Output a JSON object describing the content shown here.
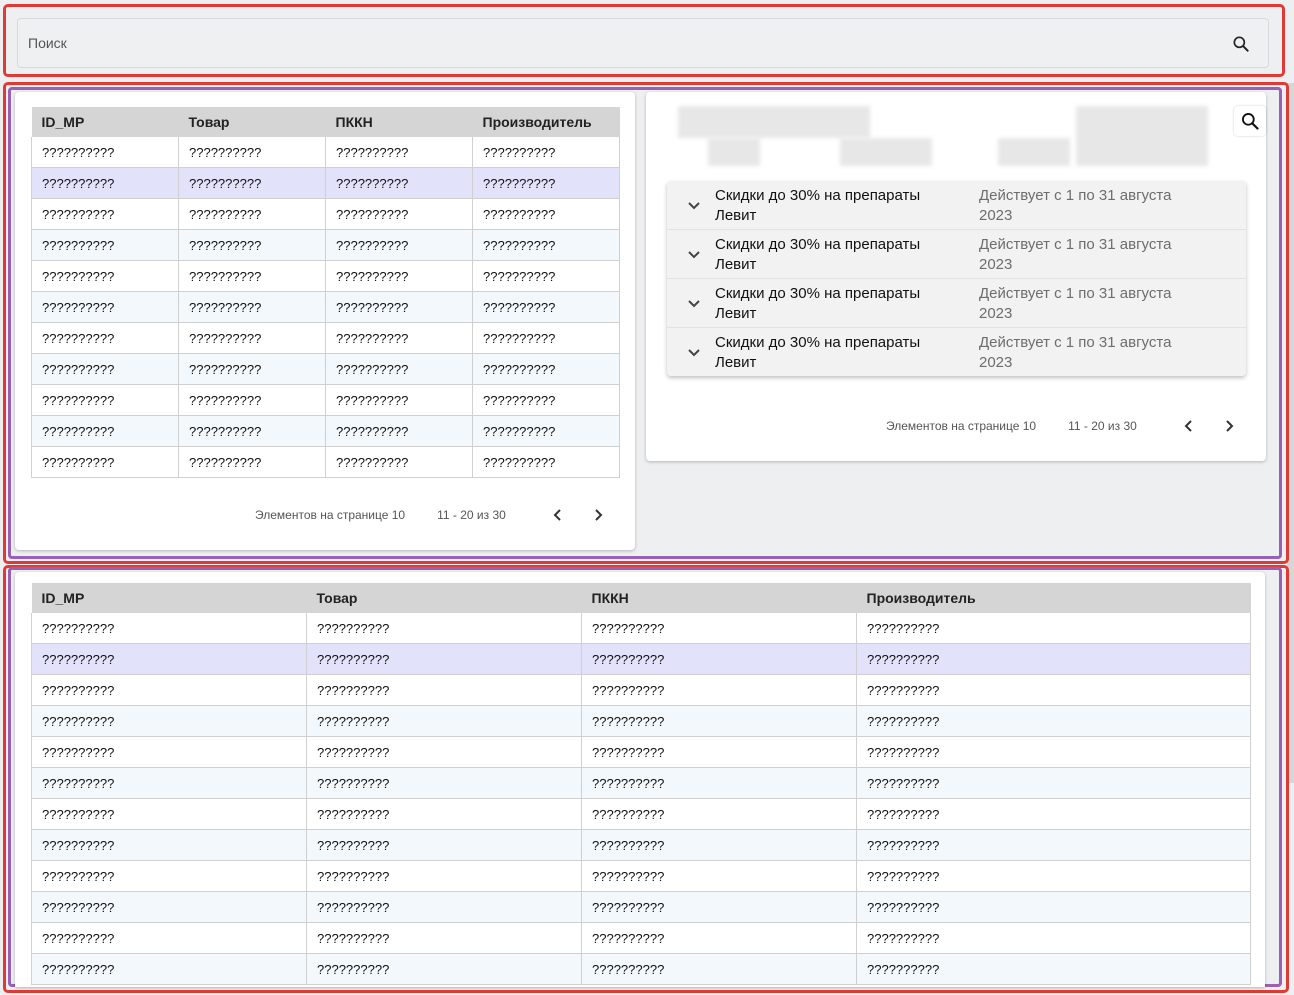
{
  "search": {
    "placeholder": "Поиск"
  },
  "left_table": {
    "columns": [
      "ID_MP",
      "Товар",
      "ПККН",
      "Производитель"
    ],
    "rows": [
      [
        "??????????",
        "??????????",
        "??????????",
        "??????????"
      ],
      [
        "??????????",
        "??????????",
        "??????????",
        "??????????"
      ],
      [
        "??????????",
        "??????????",
        "??????????",
        "??????????"
      ],
      [
        "??????????",
        "??????????",
        "??????????",
        "??????????"
      ],
      [
        "??????????",
        "??????????",
        "??????????",
        "??????????"
      ],
      [
        "??????????",
        "??????????",
        "??????????",
        "??????????"
      ],
      [
        "??????????",
        "??????????",
        "??????????",
        "??????????"
      ],
      [
        "??????????",
        "??????????",
        "??????????",
        "??????????"
      ],
      [
        "??????????",
        "??????????",
        "??????????",
        "??????????"
      ],
      [
        "??????????",
        "??????????",
        "??????????",
        "??????????"
      ],
      [
        "??????????",
        "??????????",
        "??????????",
        "??????????"
      ]
    ],
    "selected_row_index": 1,
    "paginator": {
      "items_label": "Элементов на странице 10",
      "range": "11 - 20 из 30"
    }
  },
  "promotions": {
    "items": [
      {
        "title": "Скидки до 30% на препараты Левит",
        "period": "Действует с 1 по 31 августа 2023"
      },
      {
        "title": "Скидки до 30% на препараты Левит",
        "period": "Действует с 1 по 31 августа 2023"
      },
      {
        "title": "Скидки до 30% на препараты Левит",
        "period": "Действует с 1 по 31 августа 2023"
      },
      {
        "title": "Скидки до 30% на препараты Левит",
        "period": "Действует с 1 по 31 августа 2023"
      }
    ],
    "paginator": {
      "items_label": "Элементов на странице 10",
      "range": "11 - 20 из 30"
    }
  },
  "bottom_table": {
    "columns": [
      "ID_MP",
      "Товар",
      "ПККН",
      "Производитель"
    ],
    "rows": [
      [
        "??????????",
        "??????????",
        "??????????",
        "??????????"
      ],
      [
        "??????????",
        "??????????",
        "??????????",
        "??????????"
      ],
      [
        "??????????",
        "??????????",
        "??????????",
        "??????????"
      ],
      [
        "??????????",
        "??????????",
        "??????????",
        "??????????"
      ],
      [
        "??????????",
        "??????????",
        "??????????",
        "??????????"
      ],
      [
        "??????????",
        "??????????",
        "??????????",
        "??????????"
      ],
      [
        "??????????",
        "??????????",
        "??????????",
        "??????????"
      ],
      [
        "??????????",
        "??????????",
        "??????????",
        "??????????"
      ],
      [
        "??????????",
        "??????????",
        "??????????",
        "??????????"
      ],
      [
        "??????????",
        "??????????",
        "??????????",
        "??????????"
      ],
      [
        "??????????",
        "??????????",
        "??????????",
        "??????????"
      ],
      [
        "??????????",
        "??????????",
        "??????????",
        "??????????"
      ]
    ],
    "selected_row_index": 1
  },
  "colors": {
    "frame_red": "#e03a36",
    "frame_purple": "#9a5fb6",
    "header_bg": "#d5d5d5",
    "selected_row": "#e3e2fb",
    "alt_row": "#f3f8fc"
  },
  "icons": {
    "search": "search-icon",
    "prev": "chevron-left-icon",
    "next": "chevron-right-icon",
    "expand": "chevron-down-icon"
  }
}
